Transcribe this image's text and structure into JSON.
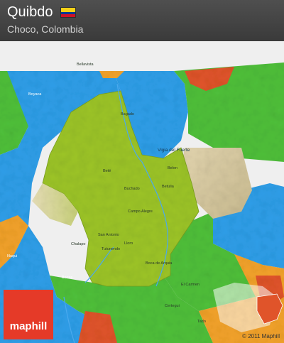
{
  "header": {
    "title": "Quibdo",
    "subtitle": "Choco, Colombia"
  },
  "flag": {
    "colors": [
      "#f7d117",
      "#003893",
      "#ce1126"
    ],
    "icon": "colombia-flag-icon"
  },
  "map": {
    "colors": {
      "background": "#efefef",
      "region_green": "#4fbf3a",
      "selected_region": "#9cc428",
      "water": "#2e9ee8",
      "orange": "#f2a22a",
      "red": "#e0542a"
    },
    "places": [
      {
        "name": "Bellavista"
      },
      {
        "name": "Boyaca"
      },
      {
        "name": "Bagado"
      },
      {
        "name": "Vigia del Fuerte"
      },
      {
        "name": "Belen"
      },
      {
        "name": "Beté"
      },
      {
        "name": "Betulia"
      },
      {
        "name": "Buchado"
      },
      {
        "name": "Campo Alegre"
      },
      {
        "name": "San Antonio"
      },
      {
        "name": "Chalapo"
      },
      {
        "name": "Lloro"
      },
      {
        "name": "Tutunendo"
      },
      {
        "name": "Boca de Arquia"
      },
      {
        "name": "Bocas"
      },
      {
        "name": "El Carmen"
      },
      {
        "name": "Tado"
      },
      {
        "name": "Certegui"
      },
      {
        "name": "Nuqui"
      }
    ]
  },
  "logo": {
    "text": "maphill"
  },
  "copyright": "© 2011 Maphill"
}
